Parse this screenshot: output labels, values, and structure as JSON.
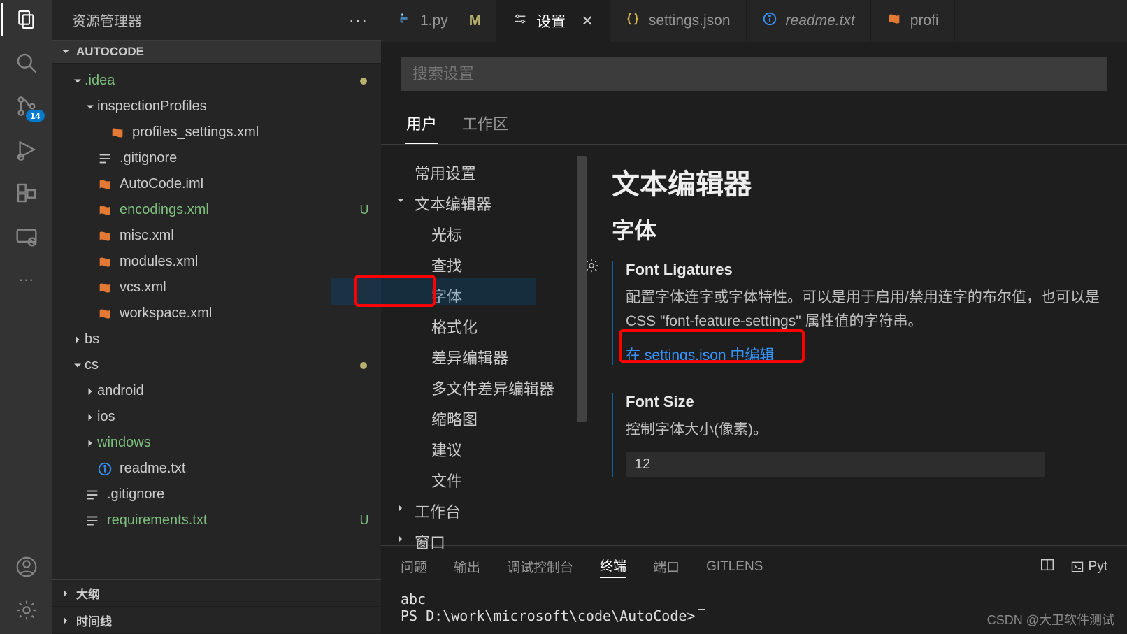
{
  "sidebar": {
    "title": "资源管理器",
    "project": "AUTOCODE",
    "outline": "大纲",
    "timeline": "时间线"
  },
  "badge": "14",
  "tree": [
    {
      "depth": 1,
      "type": "folder",
      "open": true,
      "label": ".idea",
      "green": true,
      "dot": true
    },
    {
      "depth": 2,
      "type": "folder",
      "open": true,
      "label": "inspectionProfiles"
    },
    {
      "depth": 3,
      "type": "xml",
      "label": "profiles_settings.xml"
    },
    {
      "depth": 2,
      "type": "lines",
      "label": ".gitignore"
    },
    {
      "depth": 2,
      "type": "xml",
      "label": "AutoCode.iml"
    },
    {
      "depth": 2,
      "type": "xml",
      "label": "encodings.xml",
      "green": true,
      "status": "U"
    },
    {
      "depth": 2,
      "type": "xml",
      "label": "misc.xml"
    },
    {
      "depth": 2,
      "type": "xml",
      "label": "modules.xml"
    },
    {
      "depth": 2,
      "type": "xml",
      "label": "vcs.xml"
    },
    {
      "depth": 2,
      "type": "xml",
      "label": "workspace.xml"
    },
    {
      "depth": 1,
      "type": "folder",
      "open": false,
      "label": "bs"
    },
    {
      "depth": 1,
      "type": "folder",
      "open": true,
      "label": "cs",
      "dot": true
    },
    {
      "depth": 2,
      "type": "folder",
      "open": false,
      "label": "android"
    },
    {
      "depth": 2,
      "type": "folder",
      "open": false,
      "label": "ios"
    },
    {
      "depth": 2,
      "type": "folder",
      "open": false,
      "label": "windows",
      "green": true
    },
    {
      "depth": 2,
      "type": "info",
      "label": "readme.txt"
    },
    {
      "depth": 1,
      "type": "lines",
      "label": ".gitignore"
    },
    {
      "depth": 1,
      "type": "lines",
      "label": "requirements.txt",
      "green": true,
      "status": "U"
    }
  ],
  "tabs": [
    {
      "icon": "python",
      "label": "1.py",
      "mod": "M"
    },
    {
      "icon": "settings",
      "label": "设置",
      "active": true,
      "close": true
    },
    {
      "icon": "json",
      "label": "settings.json"
    },
    {
      "icon": "info",
      "label": "readme.txt",
      "italic": true
    },
    {
      "icon": "xml",
      "label": "profi"
    }
  ],
  "settings": {
    "search_placeholder": "搜索设置",
    "scope": {
      "user": "用户",
      "workspace": "工作区"
    },
    "toc": {
      "common": "常用设置",
      "text_editor": "文本编辑器",
      "cursor": "光标",
      "find": "查找",
      "font": "字体",
      "format": "格式化",
      "diff": "差异编辑器",
      "multidiff": "多文件差异编辑器",
      "minimap": "缩略图",
      "suggest": "建议",
      "files": "文件",
      "workbench": "工作台",
      "window": "窗口"
    },
    "content": {
      "h1": "文本编辑器",
      "h2": "字体",
      "font_ligatures_title": "Font Ligatures",
      "font_ligatures_desc": "配置字体连字或字体特性。可以是用于启用/禁用连字的布尔值，也可以是 CSS \"font-feature-settings\" 属性值的字符串。",
      "edit_in_json": "在 settings.json 中编辑",
      "font_size_title": "Font Size",
      "font_size_desc": "控制字体大小(像素)。",
      "font_size_value": "12"
    }
  },
  "panel": {
    "problems": "问题",
    "output": "输出",
    "debug": "调试控制台",
    "terminal": "终端",
    "ports": "端口",
    "gitlens": "GITLENS",
    "term_lang": "Pyt",
    "line1": "abc",
    "prompt": "PS D:\\work\\microsoft\\code\\AutoCode>"
  },
  "watermark": "CSDN @大卫软件测试"
}
